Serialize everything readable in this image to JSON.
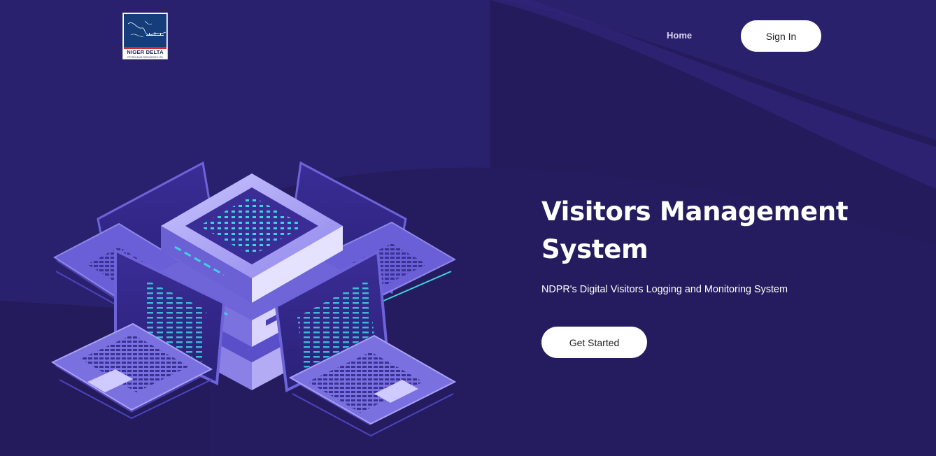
{
  "page": {
    "background": "#231b5c",
    "accent": "#3fd3e0"
  },
  "header": {
    "logo": {
      "name": "NIGER DELTA",
      "subtitle": "PETROLEUM RESOURCES LTD",
      "icon": "company-logo-icon"
    },
    "nav": {
      "home_label": "Home"
    },
    "signin_label": "Sign In"
  },
  "hero": {
    "title": "Visitors Management System",
    "subtitle": "NDPR's Digital Visitors Logging and Monitoring System",
    "cta_label": "Get Started",
    "illustration_icon": "servers-laptops-illustration"
  }
}
